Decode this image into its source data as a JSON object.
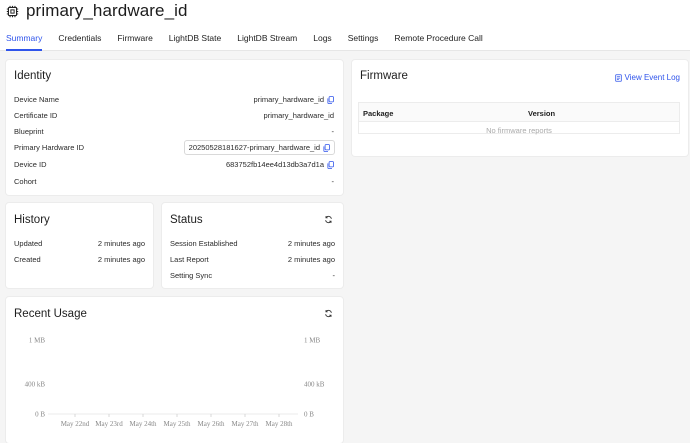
{
  "header": {
    "title": "primary_hardware_id",
    "icon": "chip-icon"
  },
  "tabs": [
    {
      "label": "Summary",
      "active": true
    },
    {
      "label": "Credentials",
      "active": false
    },
    {
      "label": "Firmware",
      "active": false
    },
    {
      "label": "LightDB State",
      "active": false
    },
    {
      "label": "LightDB Stream",
      "active": false
    },
    {
      "label": "Logs",
      "active": false
    },
    {
      "label": "Settings",
      "active": false
    },
    {
      "label": "Remote Procedure Call",
      "active": false
    }
  ],
  "identity": {
    "title": "Identity",
    "rows": [
      {
        "label": "Device Name",
        "value": "primary_hardware_id",
        "copy": true,
        "boxed": false
      },
      {
        "label": "Certificate ID",
        "value": "primary_hardware_id",
        "copy": false,
        "boxed": false
      },
      {
        "label": "Blueprint",
        "value": "-",
        "copy": false,
        "boxed": false
      },
      {
        "label": "Primary Hardware ID",
        "value": "20250528181627-primary_hardware_id",
        "copy": true,
        "boxed": true
      },
      {
        "label": "Device ID",
        "value": "683752fb14ee4d13db3a7d1a",
        "copy": true,
        "boxed": false
      },
      {
        "label": "Cohort",
        "value": "-",
        "copy": false,
        "boxed": false
      }
    ]
  },
  "firmware": {
    "title": "Firmware",
    "link": "View Event Log",
    "columns": [
      "Package",
      "Version"
    ],
    "empty_text": "No firmware reports"
  },
  "history": {
    "title": "History",
    "rows": [
      {
        "label": "Updated",
        "value": "2 minutes ago"
      },
      {
        "label": "Created",
        "value": "2 minutes ago"
      }
    ]
  },
  "status": {
    "title": "Status",
    "rows": [
      {
        "label": "Session Established",
        "value": "2 minutes ago"
      },
      {
        "label": "Last Report",
        "value": "2 minutes ago"
      },
      {
        "label": "Setting Sync",
        "value": "-"
      }
    ]
  },
  "recent_usage": {
    "title": "Recent Usage",
    "chart_data": {
      "type": "bar",
      "title": "Recent Usage",
      "categories": [
        "May 22nd",
        "May 23rd",
        "May 24th",
        "May 25th",
        "May 26th",
        "May 27th",
        "May 28th"
      ],
      "values": [
        0,
        0,
        0,
        0,
        0,
        0,
        0
      ],
      "y_ticks_left": [
        "1 MB",
        "400 kB",
        "0 B"
      ],
      "y_ticks_right": [
        "1 MB",
        "400 kB",
        "0 B"
      ],
      "ylim": [
        0,
        1000000
      ],
      "grid": false
    }
  },
  "colors": {
    "accent": "#2f54eb",
    "background": "#f5f5f5",
    "card": "#ffffff"
  }
}
